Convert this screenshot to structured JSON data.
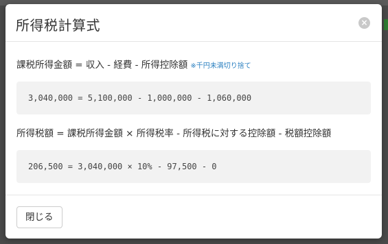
{
  "modal": {
    "title": "所得税計算式",
    "close_icon": "×"
  },
  "formulas": [
    {
      "heading": "課税所得金額 = 収入 - 経費 - 所得控除額",
      "note": "※千円未満切り捨て",
      "calculation": "3,040,000 = 5,100,000 - 1,000,000 - 1,060,000"
    },
    {
      "heading": "所得税額 = 課税所得金額 × 所得税率 - 所得税に対する控除額 - 税額控除額",
      "calculation": "206,500 = 3,040,000 × 10% - 97,500 - 0"
    }
  ],
  "footer": {
    "close_label": "閉じる"
  },
  "colors": {
    "note_link": "#2a7fc0",
    "formula_box_bg": "#f2f2f2",
    "backdrop": "#4a4a4a"
  }
}
